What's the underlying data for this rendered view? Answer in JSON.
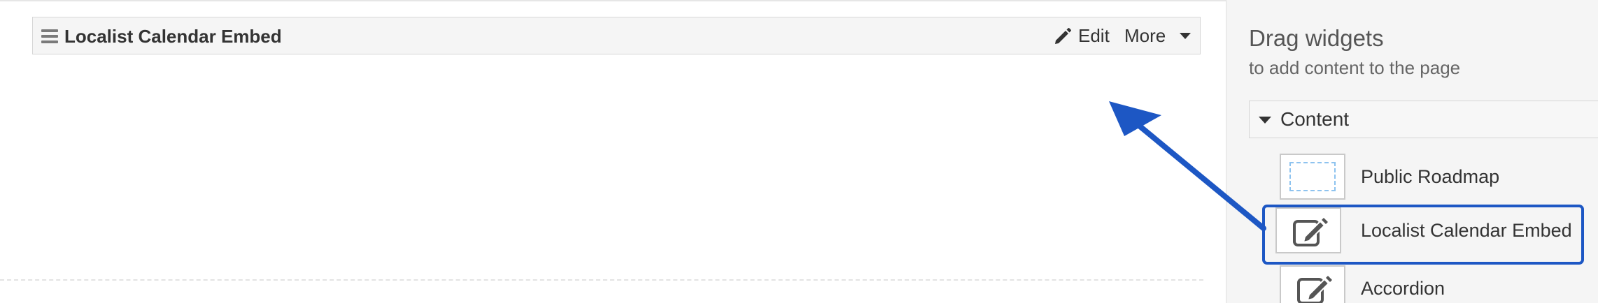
{
  "main": {
    "widget": {
      "title": "Localist Calendar Embed",
      "edit_label": "Edit",
      "more_label": "More"
    }
  },
  "sidebar": {
    "heading": "Drag widgets",
    "subheading": "to add content to the page",
    "category": {
      "label": "Content",
      "expanded": true
    },
    "widgets": [
      {
        "label": "Public Roadmap",
        "icon": "dashed-box-icon"
      },
      {
        "label": "Localist Calendar Embed",
        "icon": "edit-square-icon",
        "highlighted": true
      },
      {
        "label": "Accordion",
        "icon": "edit-square-icon"
      }
    ]
  },
  "annotation": {
    "arrow_color": "#1d57c4",
    "highlight_color": "#1d57c4"
  }
}
